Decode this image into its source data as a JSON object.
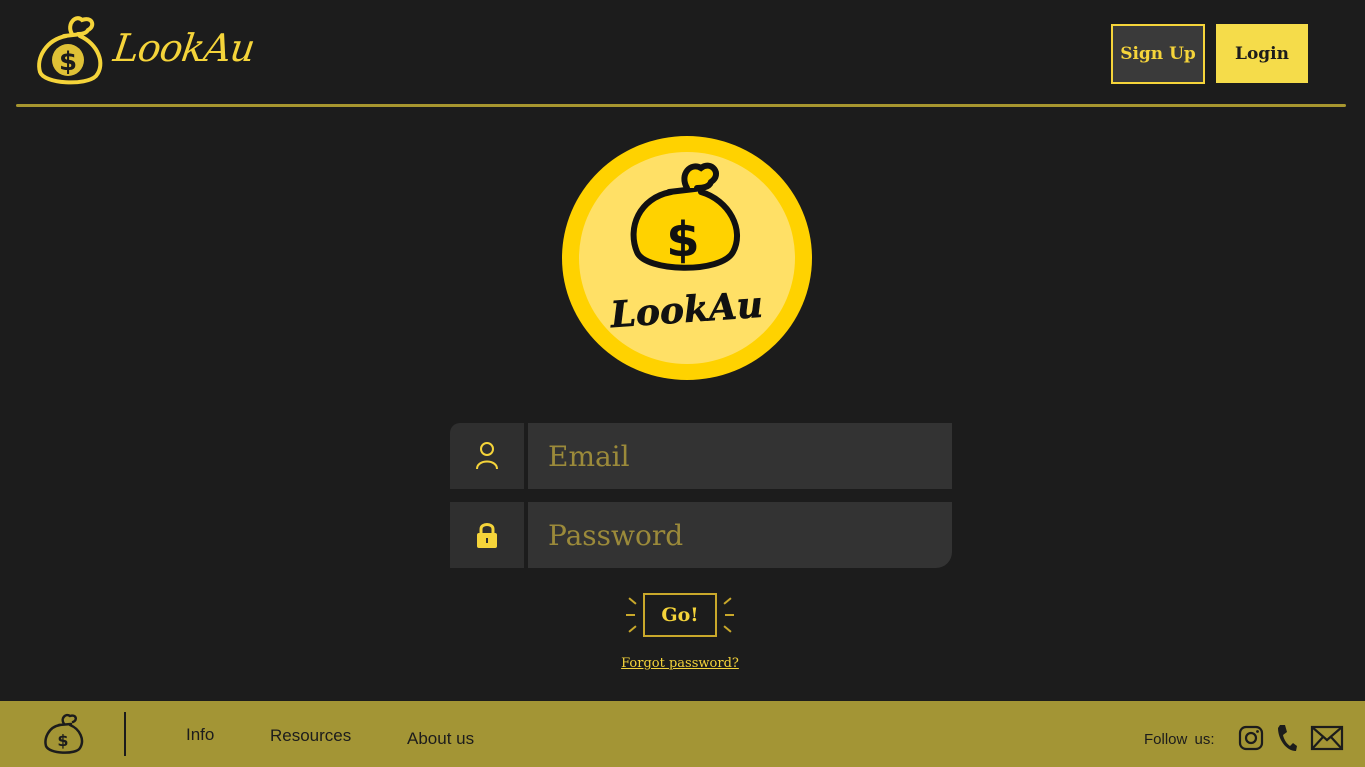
{
  "header": {
    "brand_name": "LookAu",
    "signup_label": "Sign Up",
    "login_label": "Login"
  },
  "hero": {
    "logo_text": "LookAu"
  },
  "form": {
    "email_placeholder": "Email",
    "password_placeholder": "Password",
    "submit_label": "Go!",
    "forgot_label": "Forgot password?"
  },
  "footer": {
    "links": [
      "Info",
      "Resources",
      "About us"
    ],
    "follow_label": "Follow us:",
    "social": [
      "instagram-icon",
      "phone-icon",
      "mail-icon"
    ]
  },
  "colors": {
    "background": "#1c1c1c",
    "accent_yellow": "#f5d43a",
    "footer_olive": "#a39535",
    "field_bg": "#333333"
  }
}
